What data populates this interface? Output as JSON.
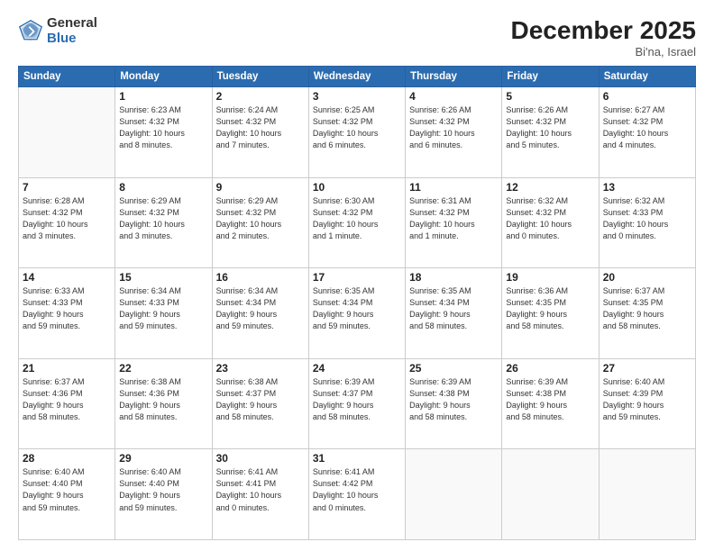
{
  "header": {
    "logo_general": "General",
    "logo_blue": "Blue",
    "month_title": "December 2025",
    "location": "Bi'na, Israel"
  },
  "weekdays": [
    "Sunday",
    "Monday",
    "Tuesday",
    "Wednesday",
    "Thursday",
    "Friday",
    "Saturday"
  ],
  "weeks": [
    [
      {
        "day": "",
        "info": ""
      },
      {
        "day": "1",
        "info": "Sunrise: 6:23 AM\nSunset: 4:32 PM\nDaylight: 10 hours\nand 8 minutes."
      },
      {
        "day": "2",
        "info": "Sunrise: 6:24 AM\nSunset: 4:32 PM\nDaylight: 10 hours\nand 7 minutes."
      },
      {
        "day": "3",
        "info": "Sunrise: 6:25 AM\nSunset: 4:32 PM\nDaylight: 10 hours\nand 6 minutes."
      },
      {
        "day": "4",
        "info": "Sunrise: 6:26 AM\nSunset: 4:32 PM\nDaylight: 10 hours\nand 6 minutes."
      },
      {
        "day": "5",
        "info": "Sunrise: 6:26 AM\nSunset: 4:32 PM\nDaylight: 10 hours\nand 5 minutes."
      },
      {
        "day": "6",
        "info": "Sunrise: 6:27 AM\nSunset: 4:32 PM\nDaylight: 10 hours\nand 4 minutes."
      }
    ],
    [
      {
        "day": "7",
        "info": "Sunrise: 6:28 AM\nSunset: 4:32 PM\nDaylight: 10 hours\nand 3 minutes."
      },
      {
        "day": "8",
        "info": "Sunrise: 6:29 AM\nSunset: 4:32 PM\nDaylight: 10 hours\nand 3 minutes."
      },
      {
        "day": "9",
        "info": "Sunrise: 6:29 AM\nSunset: 4:32 PM\nDaylight: 10 hours\nand 2 minutes."
      },
      {
        "day": "10",
        "info": "Sunrise: 6:30 AM\nSunset: 4:32 PM\nDaylight: 10 hours\nand 1 minute."
      },
      {
        "day": "11",
        "info": "Sunrise: 6:31 AM\nSunset: 4:32 PM\nDaylight: 10 hours\nand 1 minute."
      },
      {
        "day": "12",
        "info": "Sunrise: 6:32 AM\nSunset: 4:32 PM\nDaylight: 10 hours\nand 0 minutes."
      },
      {
        "day": "13",
        "info": "Sunrise: 6:32 AM\nSunset: 4:33 PM\nDaylight: 10 hours\nand 0 minutes."
      }
    ],
    [
      {
        "day": "14",
        "info": "Sunrise: 6:33 AM\nSunset: 4:33 PM\nDaylight: 9 hours\nand 59 minutes."
      },
      {
        "day": "15",
        "info": "Sunrise: 6:34 AM\nSunset: 4:33 PM\nDaylight: 9 hours\nand 59 minutes."
      },
      {
        "day": "16",
        "info": "Sunrise: 6:34 AM\nSunset: 4:34 PM\nDaylight: 9 hours\nand 59 minutes."
      },
      {
        "day": "17",
        "info": "Sunrise: 6:35 AM\nSunset: 4:34 PM\nDaylight: 9 hours\nand 59 minutes."
      },
      {
        "day": "18",
        "info": "Sunrise: 6:35 AM\nSunset: 4:34 PM\nDaylight: 9 hours\nand 58 minutes."
      },
      {
        "day": "19",
        "info": "Sunrise: 6:36 AM\nSunset: 4:35 PM\nDaylight: 9 hours\nand 58 minutes."
      },
      {
        "day": "20",
        "info": "Sunrise: 6:37 AM\nSunset: 4:35 PM\nDaylight: 9 hours\nand 58 minutes."
      }
    ],
    [
      {
        "day": "21",
        "info": "Sunrise: 6:37 AM\nSunset: 4:36 PM\nDaylight: 9 hours\nand 58 minutes."
      },
      {
        "day": "22",
        "info": "Sunrise: 6:38 AM\nSunset: 4:36 PM\nDaylight: 9 hours\nand 58 minutes."
      },
      {
        "day": "23",
        "info": "Sunrise: 6:38 AM\nSunset: 4:37 PM\nDaylight: 9 hours\nand 58 minutes."
      },
      {
        "day": "24",
        "info": "Sunrise: 6:39 AM\nSunset: 4:37 PM\nDaylight: 9 hours\nand 58 minutes."
      },
      {
        "day": "25",
        "info": "Sunrise: 6:39 AM\nSunset: 4:38 PM\nDaylight: 9 hours\nand 58 minutes."
      },
      {
        "day": "26",
        "info": "Sunrise: 6:39 AM\nSunset: 4:38 PM\nDaylight: 9 hours\nand 58 minutes."
      },
      {
        "day": "27",
        "info": "Sunrise: 6:40 AM\nSunset: 4:39 PM\nDaylight: 9 hours\nand 59 minutes."
      }
    ],
    [
      {
        "day": "28",
        "info": "Sunrise: 6:40 AM\nSunset: 4:40 PM\nDaylight: 9 hours\nand 59 minutes."
      },
      {
        "day": "29",
        "info": "Sunrise: 6:40 AM\nSunset: 4:40 PM\nDaylight: 9 hours\nand 59 minutes."
      },
      {
        "day": "30",
        "info": "Sunrise: 6:41 AM\nSunset: 4:41 PM\nDaylight: 10 hours\nand 0 minutes."
      },
      {
        "day": "31",
        "info": "Sunrise: 6:41 AM\nSunset: 4:42 PM\nDaylight: 10 hours\nand 0 minutes."
      },
      {
        "day": "",
        "info": ""
      },
      {
        "day": "",
        "info": ""
      },
      {
        "day": "",
        "info": ""
      }
    ]
  ]
}
